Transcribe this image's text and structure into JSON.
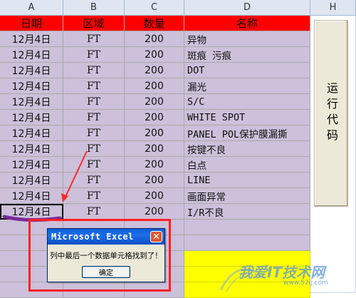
{
  "columns": [
    "A",
    "B",
    "C",
    "D",
    "H"
  ],
  "header_row": [
    "日期",
    "区域",
    "数量",
    "名称"
  ],
  "rows": [
    {
      "date": "12月4日",
      "area": "FT",
      "qty": "200",
      "name": "异物"
    },
    {
      "date": "12月4日",
      "area": "FT",
      "qty": "200",
      "name": "斑痕 污痕"
    },
    {
      "date": "12月4日",
      "area": "FT",
      "qty": "200",
      "name": "DOT"
    },
    {
      "date": "12月4日",
      "area": "FT",
      "qty": "200",
      "name": "漏光"
    },
    {
      "date": "12月4日",
      "area": "FT",
      "qty": "200",
      "name": "S/C"
    },
    {
      "date": "12月4日",
      "area": "FT",
      "qty": "200",
      "name": "WHITE SPOT"
    },
    {
      "date": "12月4日",
      "area": "FT",
      "qty": "200",
      "name": "PANEL POL保护膜漏撕"
    },
    {
      "date": "12月4日",
      "area": "FT",
      "qty": "200",
      "name": "按键不良"
    },
    {
      "date": "12月4日",
      "area": "FT",
      "qty": "200",
      "name": "白点"
    },
    {
      "date": "12月4日",
      "area": "FT",
      "qty": "200",
      "name": "LINE"
    },
    {
      "date": "12月4日",
      "area": "FT",
      "qty": "200",
      "name": "画面异常"
    },
    {
      "date": "12月4日",
      "area": "FT",
      "qty": "200",
      "name": "I/R不良"
    }
  ],
  "run_button_label": "运行代码",
  "dialog": {
    "title": "Microsoft Excel",
    "close_glyph": "✕",
    "message": "列中最后一个数据单元格找到了！",
    "ok_label": "确定"
  },
  "watermark": {
    "text": "我爱IT技术网",
    "sub": "www.52ij.com"
  },
  "colors": {
    "header_red": "#ff0000",
    "purple": "#ccc0da",
    "yellow": "#ffff00",
    "annotation_red": "#ff2020"
  }
}
